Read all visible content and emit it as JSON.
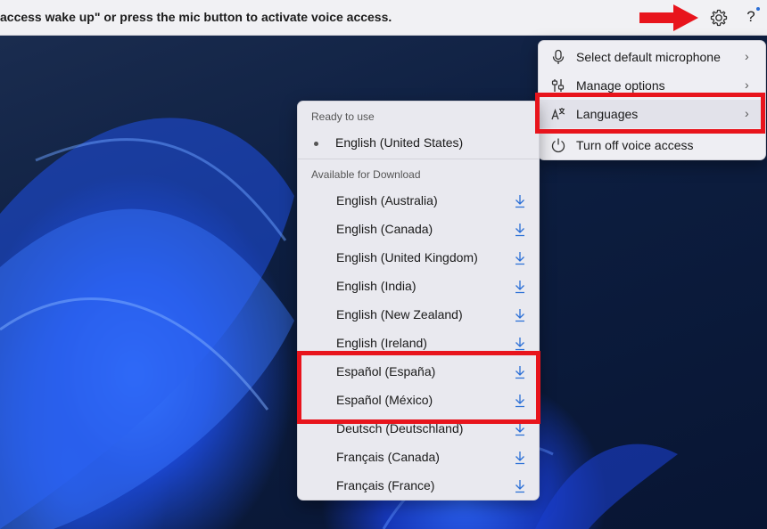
{
  "voice_bar": {
    "message": "access wake up\" or press the mic button to activate voice access.",
    "settings_icon": "gear-icon",
    "help_label": "?"
  },
  "menu": {
    "items": [
      {
        "label": "Select default microphone",
        "icon": "microphone-icon"
      },
      {
        "label": "Manage options",
        "icon": "options-icon"
      },
      {
        "label": "Languages",
        "icon": "language-icon"
      },
      {
        "label": "Turn off voice access",
        "icon": "power-icon"
      }
    ]
  },
  "languages": {
    "ready_heading": "Ready to use",
    "current": "English (United States)",
    "available_heading": "Available for Download",
    "available": [
      "English (Australia)",
      "English (Canada)",
      "English (United Kingdom)",
      "English (India)",
      "English (New Zealand)",
      "English (Ireland)",
      "Español (España)",
      "Español (México)",
      "Deutsch (Deutschland)",
      "Français (Canada)",
      "Français (France)"
    ]
  },
  "colors": {
    "highlight": "#e8141c",
    "accent": "#2b6fd6"
  }
}
